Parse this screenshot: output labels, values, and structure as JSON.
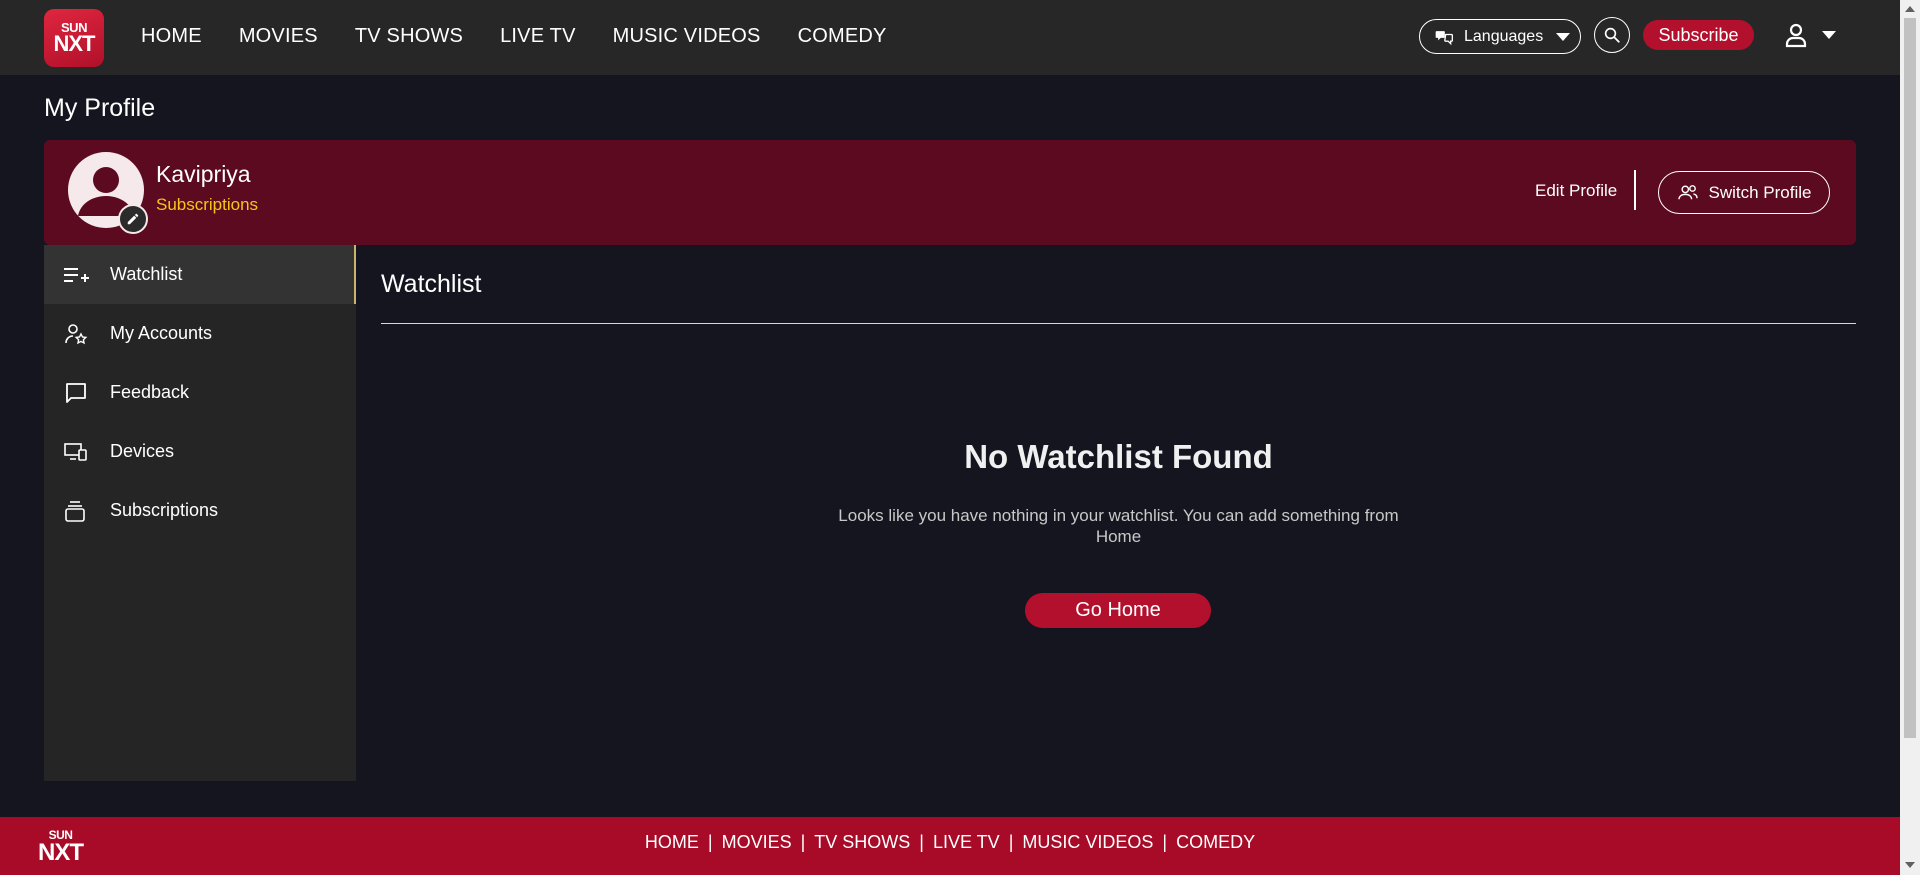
{
  "brand": {
    "logo_top": "SUN",
    "logo_bottom": "NXT"
  },
  "header": {
    "nav": [
      "HOME",
      "MOVIES",
      "TV SHOWS",
      "LIVE TV",
      "MUSIC VIDEOS",
      "COMEDY"
    ],
    "languages_label": "Languages",
    "subscribe_label": "Subscribe"
  },
  "page": {
    "title": "My Profile"
  },
  "profile": {
    "name": "Kavipriya",
    "subtitle": "Subscriptions",
    "edit_label": "Edit Profile",
    "switch_label": "Switch Profile"
  },
  "sidebar": {
    "items": [
      {
        "label": "Watchlist",
        "icon": "playlist-add-icon",
        "active": true
      },
      {
        "label": "My Accounts",
        "icon": "account-star-icon",
        "active": false
      },
      {
        "label": "Feedback",
        "icon": "message-icon",
        "active": false
      },
      {
        "label": "Devices",
        "icon": "devices-icon",
        "active": false
      },
      {
        "label": "Subscriptions",
        "icon": "subscriptions-icon",
        "active": false
      }
    ]
  },
  "main": {
    "title": "Watchlist",
    "empty_title": "No Watchlist Found",
    "empty_desc": "Looks like you have nothing in your watchlist. You can add something from Home",
    "go_home_label": "Go Home"
  },
  "footer": {
    "nav": [
      "HOME",
      "MOVIES",
      "TV SHOWS",
      "LIVE TV",
      "MUSIC VIDEOS",
      "COMEDY"
    ]
  },
  "colors": {
    "accent": "#b3102e",
    "banner": "#5c0a20",
    "background": "#151520",
    "header": "#272727",
    "sidebar": "#252525",
    "highlight": "#f5c518"
  }
}
